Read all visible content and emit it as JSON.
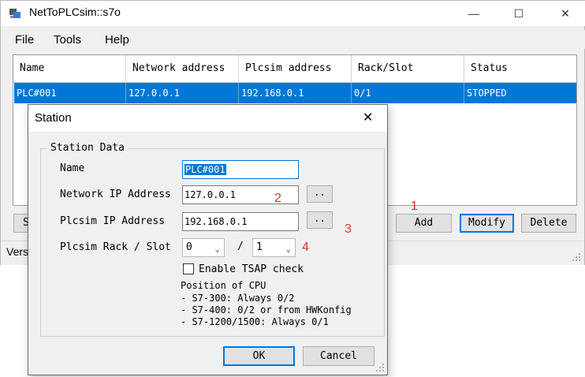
{
  "window": {
    "title": "NetToPLCsim::s7o",
    "minimize": "—",
    "maximize": "☐",
    "close": "✕"
  },
  "menu": [
    "File",
    "Tools",
    "Help"
  ],
  "table": {
    "headers": [
      "Name",
      "Network address",
      "Plcsim address",
      "Rack/Slot",
      "Status"
    ],
    "rows": [
      [
        "PLC#001",
        "127.0.0.1",
        "192.168.0.1",
        "0/1",
        "STOPPED"
      ]
    ]
  },
  "main_buttons": {
    "start_partial": "St",
    "add": "Add",
    "modify": "Modify",
    "delete": "Delete"
  },
  "status_bar": {
    "text": "Vers"
  },
  "dialog": {
    "title": "Station",
    "close": "✕",
    "group_title": "Station Data",
    "name_label": "Name",
    "name_value": "PLC#001",
    "network_ip_label": "Network IP Address",
    "network_ip_value": "127.0.0.1",
    "plcsim_ip_label": "Plcsim IP Address",
    "plcsim_ip_value": "192.168.0.1",
    "browse": "..",
    "rack_slot_label": "Plcsim Rack / Slot",
    "rack_value": "0",
    "slash": "/",
    "slot_value": "1",
    "tsap_label": "Enable TSAP check",
    "cpu_info": [
      "Position of CPU",
      "- S7-300: Always 0/2",
      "- S7-400: 0/2 or from HWKonfig",
      "- S7-1200/1500: Always 0/1"
    ],
    "ok": "OK",
    "cancel": "Cancel"
  },
  "annotations": [
    "1",
    "2",
    "3",
    "4"
  ],
  "colors": {
    "selection": "#0078d7",
    "annotation": "#e0302a",
    "dialog_bg": "#f0f0f0"
  }
}
